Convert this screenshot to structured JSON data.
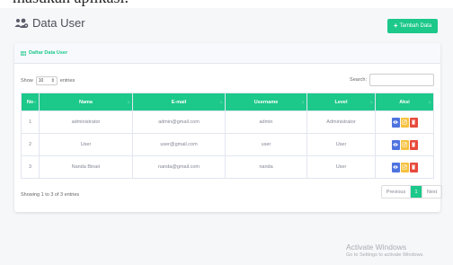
{
  "cut_top_text": "masukan aplikasi.",
  "page": {
    "title": "Data User",
    "add_button": "Tambah Data"
  },
  "card": {
    "title": "Daftar Data User"
  },
  "controls": {
    "show_label": "Show",
    "length_value": "10",
    "entries_label": "entries",
    "search_label": "Search:"
  },
  "table": {
    "headers": [
      "No",
      "Nama",
      "E-mail",
      "Username",
      "Level",
      "Aksi"
    ],
    "rows": [
      [
        "1",
        "administrator",
        "admin@gmail.com",
        "admin",
        "Administrator"
      ],
      [
        "2",
        "User",
        "user@gmail.com",
        "user",
        "User"
      ],
      [
        "3",
        "Nanda Binari",
        "nanda@gmail.com",
        "nanda",
        "User"
      ]
    ]
  },
  "footer": {
    "info": "Showing 1 to 3 of 3 entries",
    "prev": "Previous",
    "current": "1",
    "next": "Next"
  },
  "watermark": {
    "line1": "Activate Windows",
    "line2": "Go to Settings to activate Windows."
  },
  "colors": {
    "accent": "#1cc88a",
    "view": "#4e73df",
    "edit": "#f6c23e",
    "delete": "#e74a3b"
  },
  "icons": {
    "header": "users-cog-icon",
    "card": "table-icon",
    "add": "plus-icon",
    "actions": [
      "eye-icon",
      "edit-icon",
      "trash-icon"
    ]
  }
}
